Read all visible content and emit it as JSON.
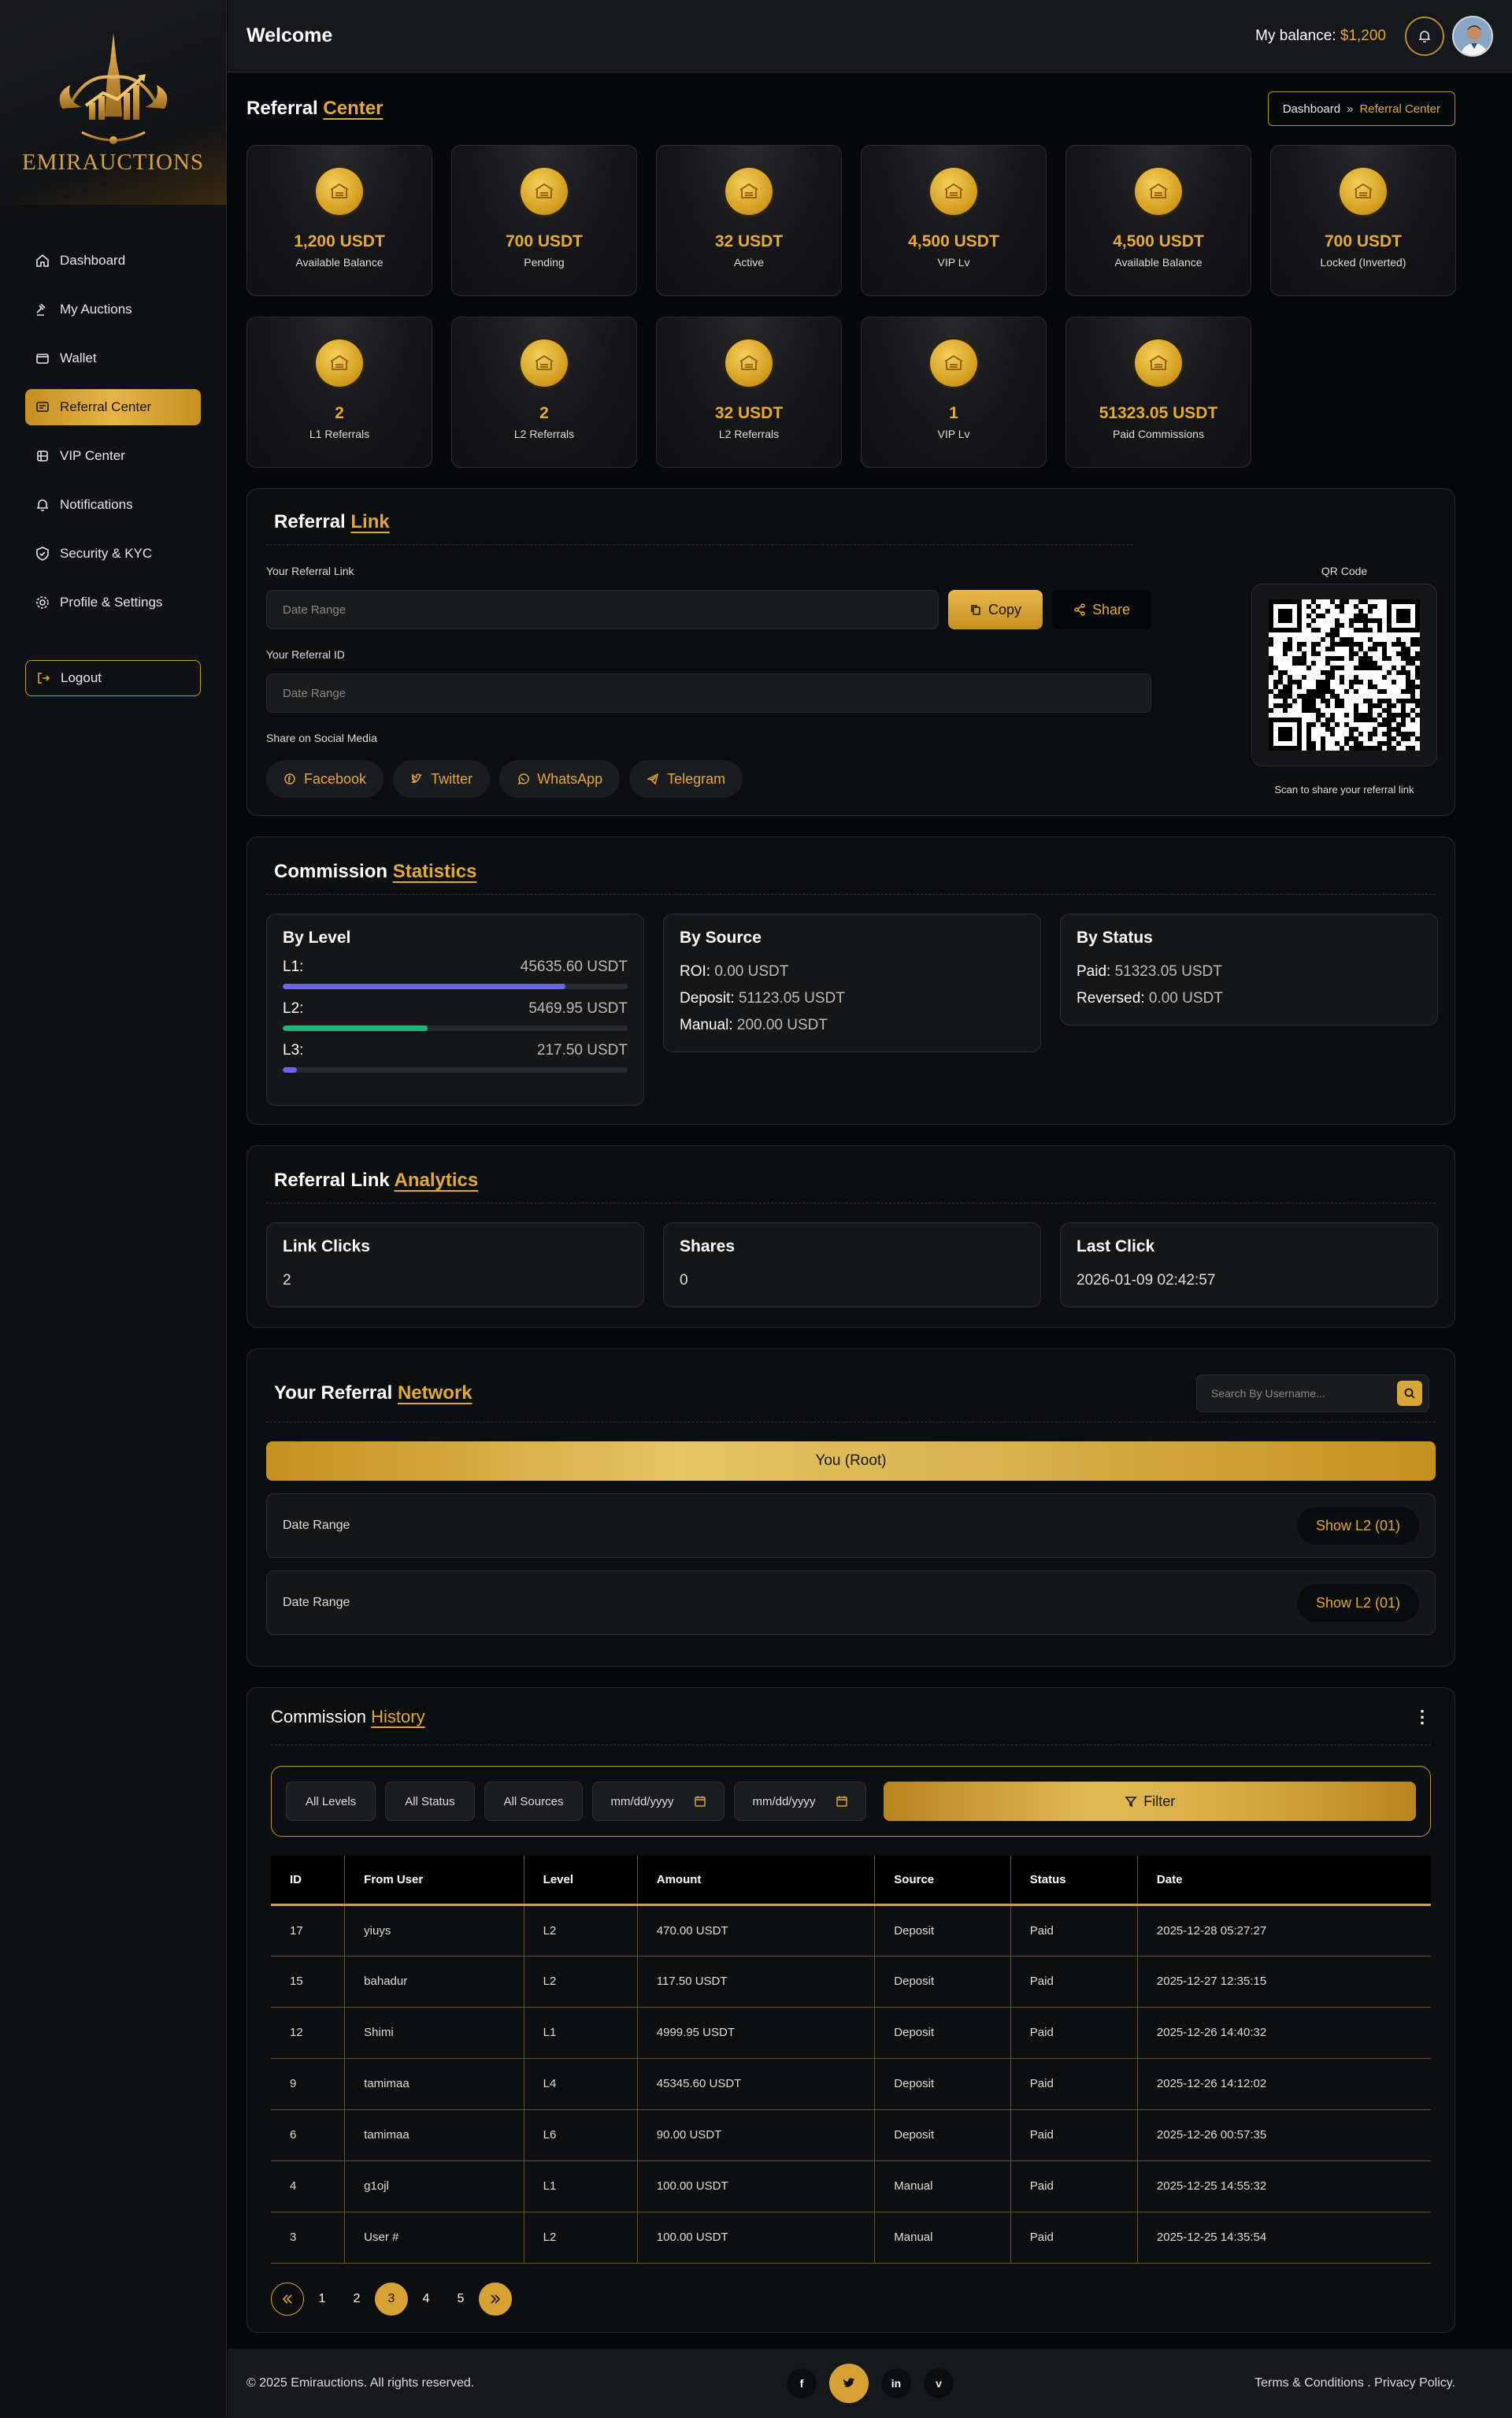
{
  "app": {
    "logo_text": "EMIRAUCTIONS"
  },
  "sidebar": {
    "items": [
      {
        "label": "Dashboard",
        "icon": "home-icon"
      },
      {
        "label": "My Auctions",
        "icon": "gavel-icon"
      },
      {
        "label": "Wallet",
        "icon": "wallet-icon"
      },
      {
        "label": "Referral Center",
        "icon": "referral-icon",
        "active": true
      },
      {
        "label": "VIP Center",
        "icon": "vip-icon"
      },
      {
        "label": "Notifications",
        "icon": "bell-icon"
      },
      {
        "label": "Security & KYC",
        "icon": "shield-icon"
      },
      {
        "label": "Profile & Settings",
        "icon": "gear-icon"
      }
    ],
    "logout_label": "Logout"
  },
  "topbar": {
    "welcome": "Welcome",
    "balance_label": "My balance:",
    "balance_value": "$1,200"
  },
  "page": {
    "title_main": "Referral",
    "title_accent": "Center",
    "breadcrumb": {
      "home": "Dashboard",
      "current": "Referral Center"
    }
  },
  "stat_cards": [
    {
      "value": "1,200 USDT",
      "label": "Available Balance"
    },
    {
      "value": "700 USDT",
      "label": "Pending"
    },
    {
      "value": "32 USDT",
      "label": "Active"
    },
    {
      "value": "4,500 USDT",
      "label": "VIP Lv"
    },
    {
      "value": "4,500 USDT",
      "label": "Available Balance"
    },
    {
      "value": "700 USDT",
      "label": "Locked (Inverted)"
    },
    {
      "value": "2",
      "label": "L1 Referrals"
    },
    {
      "value": "2",
      "label": "L2 Referrals"
    },
    {
      "value": "32 USDT",
      "label": "L2 Referrals"
    },
    {
      "value": "1",
      "label": "VIP Lv"
    },
    {
      "value": "51323.05 USDT",
      "label": "Paid Commissions"
    }
  ],
  "referral_link": {
    "title_main": "Referral",
    "title_accent": "Link",
    "link_label": "Your Referral Link",
    "link_placeholder": "Date Range",
    "copy_label": "Copy",
    "share_label": "Share",
    "id_label": "Your Referral ID",
    "id_placeholder": "Date Range",
    "social_label": "Share on Social Media",
    "socials": [
      "Facebook",
      "Twitter",
      "WhatsApp",
      "Telegram"
    ],
    "qr_title": "QR Code",
    "qr_caption": "Scan to share your referral link"
  },
  "commission_stats": {
    "title_main": "Commission",
    "title_accent": "Statistics",
    "by_level": {
      "title": "By Level",
      "rows": [
        {
          "label": "L1:",
          "value": "45635.60 USDT",
          "fraction": 0.82,
          "color": "#6a64f0"
        },
        {
          "label": "L2:",
          "value": "5469.95 USDT",
          "fraction": 0.42,
          "color": "#1fb57a"
        },
        {
          "label": "L3:",
          "value": "217.50 USDT",
          "fraction": 0.04,
          "color": "#6a64f0"
        }
      ]
    },
    "by_source": {
      "title": "By Source",
      "rows": [
        {
          "k": "ROI:",
          "v": "0.00 USDT"
        },
        {
          "k": "Deposit:",
          "v": "51123.05 USDT"
        },
        {
          "k": "Manual:",
          "v": "200.00 USDT"
        }
      ]
    },
    "by_status": {
      "title": "By Status",
      "rows": [
        {
          "k": "Paid:",
          "v": "51323.05 USDT"
        },
        {
          "k": "Reversed:",
          "v": "0.00 USDT"
        }
      ]
    }
  },
  "analytics": {
    "title_main": "Referral Link",
    "title_accent": "Analytics",
    "cards": [
      {
        "title": "Link Clicks",
        "value": "2"
      },
      {
        "title": "Shares",
        "value": "0"
      },
      {
        "title": "Last Click",
        "value": "2026-01-09 02:42:57"
      }
    ]
  },
  "network": {
    "title_main": "Your Referral",
    "title_accent": "Network",
    "search_placeholder": "Search By Username...",
    "root_label": "You (Root)",
    "rows": [
      {
        "name": "Date Range",
        "action": "Show L2 (01)"
      },
      {
        "name": "Date Range",
        "action": "Show L2 (01)"
      }
    ]
  },
  "history": {
    "title_main": "Commission",
    "title_accent": "History",
    "filters": {
      "levels": "All Levels",
      "status": "All Status",
      "sources": "All Sources",
      "date_from": "mm/dd/yyyy",
      "date_to": "mm/dd/yyyy",
      "filter_label": "Filter"
    },
    "columns": [
      "ID",
      "From User",
      "Level",
      "Amount",
      "Source",
      "Status",
      "Date"
    ],
    "rows": [
      [
        "17",
        "yiuys",
        "L2",
        "470.00 USDT",
        "Deposit",
        "Paid",
        "2025-12-28 05:27:27"
      ],
      [
        "15",
        "bahadur",
        "L2",
        "117.50 USDT",
        "Deposit",
        "Paid",
        "2025-12-27 12:35:15"
      ],
      [
        "12",
        "Shimi",
        "L1",
        "4999.95 USDT",
        "Deposit",
        "Paid",
        "2025-12-26 14:40:32"
      ],
      [
        "9",
        "tamimaa",
        "L4",
        "45345.60 USDT",
        "Deposit",
        "Paid",
        "2025-12-26 14:12:02"
      ],
      [
        "6",
        "tamimaa",
        "L6",
        "90.00 USDT",
        "Deposit",
        "Paid",
        "2025-12-26 00:57:35"
      ],
      [
        "4",
        "g1ojl",
        "L1",
        "100.00 USDT",
        "Manual",
        "Paid",
        "2025-12-25 14:55:32"
      ],
      [
        "3",
        "User #",
        "L2",
        "100.00 USDT",
        "Manual",
        "Paid",
        "2025-12-25 14:35:54"
      ]
    ],
    "pages": [
      "1",
      "2",
      "3",
      "4",
      "5"
    ],
    "current_page": "3"
  },
  "footer": {
    "copyright": "© 2025 Emirauctions. All rights reserved.",
    "socials": [
      "f",
      "t",
      "in",
      "v"
    ],
    "terms": "Terms & Conditions . Privacy Policy."
  },
  "colors": {
    "accent": "#e0a93a",
    "bg": "#06080b",
    "panel": "#0d0e10"
  }
}
